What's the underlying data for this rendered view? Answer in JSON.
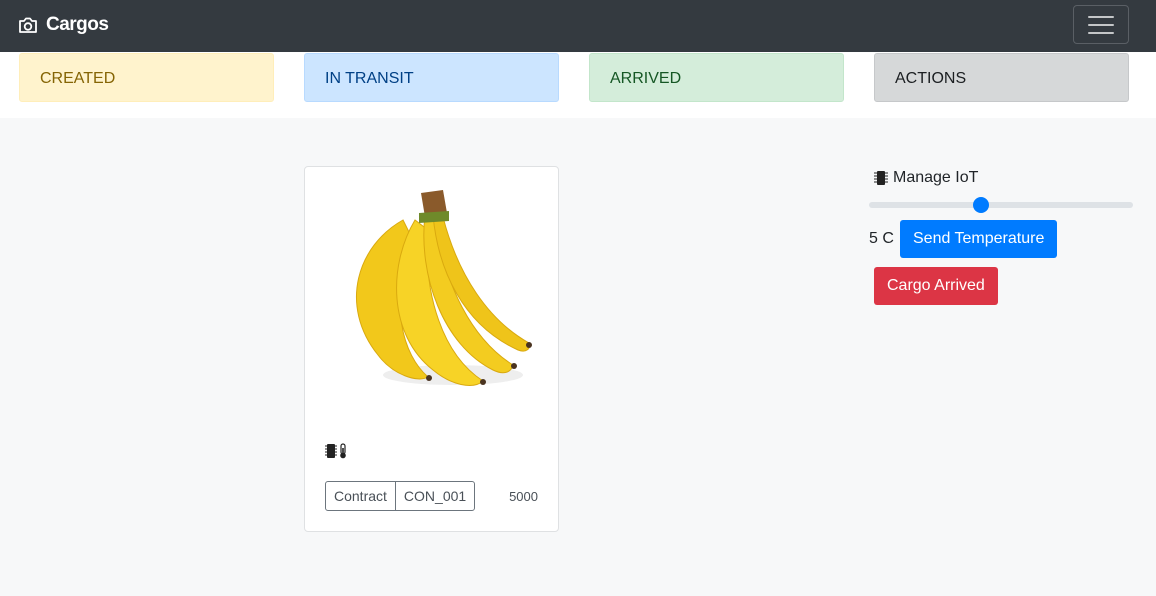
{
  "navbar": {
    "brand": "Cargos",
    "brand_icon": "camera-icon",
    "menu_icon": "hamburger-menu-icon"
  },
  "statuses": [
    {
      "label": "CREATED",
      "color": "#fff3cd"
    },
    {
      "label": "IN TRANSIT",
      "color": "#cce5ff"
    },
    {
      "label": "ARRIVED",
      "color": "#d4edda"
    },
    {
      "label": "ACTIONS",
      "color": "#d6d8d9"
    }
  ],
  "cargo_card": {
    "image": "banana-bunch-image",
    "sensor_icons": [
      "chip-icon",
      "thermometer-icon"
    ],
    "contract_label": "Contract",
    "contract_id": "CON_001",
    "amount": "5000"
  },
  "iot": {
    "title": "Manage IoT",
    "icon": "chip-icon",
    "slider_fraction": 0.42,
    "temperature_display": "5 C",
    "send_button": "Send Temperature",
    "arrived_button": "Cargo Arrived"
  },
  "colors": {
    "primary": "#007bff",
    "danger": "#dc3545",
    "navbar": "#343a40"
  }
}
